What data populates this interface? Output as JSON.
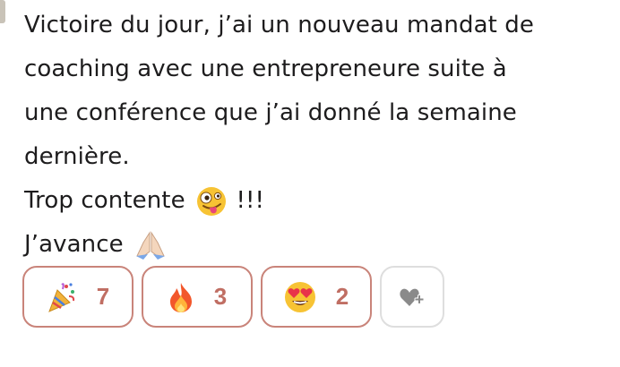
{
  "message": {
    "lines": [
      "Victoire du jour, j’ai un nouveau mandat de",
      "coaching avec une entrepreneure suite à",
      "une conférence que j’ai donné la semaine",
      "dernière.",
      "Trop contente",
      "!!!",
      "J’avance"
    ],
    "emojis": [
      "zany-face-emoji",
      "folded-hands-emoji"
    ]
  },
  "reactions": [
    {
      "icon": "party-popper-emoji",
      "count": "7"
    },
    {
      "icon": "fire-emoji",
      "count": "3"
    },
    {
      "icon": "heart-eyes-emoji",
      "count": "2"
    }
  ],
  "add_reaction": {
    "icon": "add-reaction-heart-icon"
  },
  "colors": {
    "reaction_border": "#c9847a",
    "reaction_count": "#c06e63",
    "add_border": "#dedede",
    "text": "#1d1c1d"
  }
}
